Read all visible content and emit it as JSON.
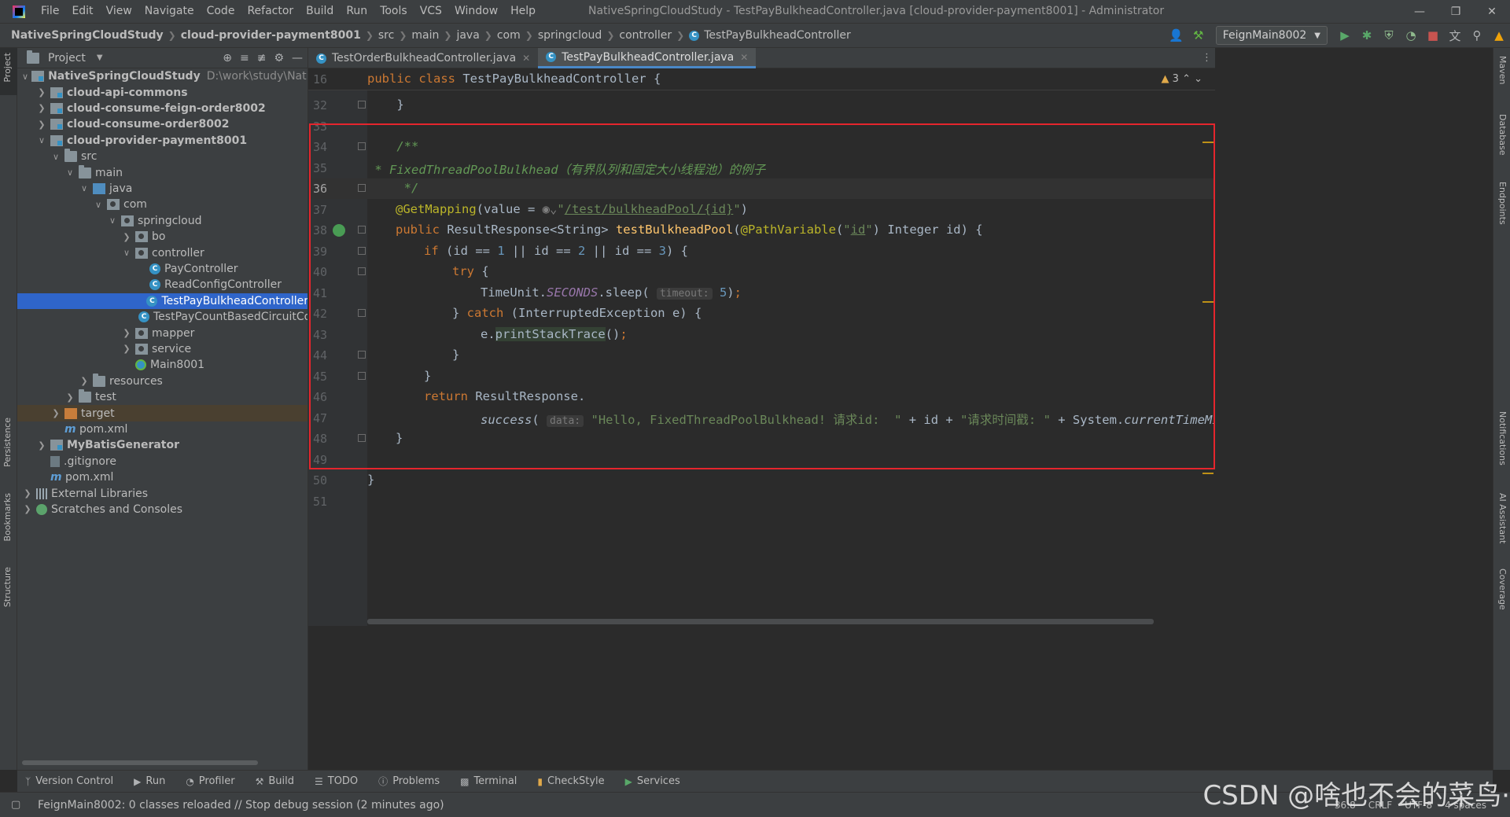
{
  "menu": [
    "File",
    "Edit",
    "View",
    "Navigate",
    "Code",
    "Refactor",
    "Build",
    "Run",
    "Tools",
    "VCS",
    "Window",
    "Help"
  ],
  "window_title": "NativeSpringCloudStudy - TestPayBulkheadController.java [cloud-provider-payment8001] - Administrator",
  "breadcrumbs": [
    "NativeSpringCloudStudy",
    "cloud-provider-payment8001",
    "src",
    "main",
    "java",
    "com",
    "springcloud",
    "controller",
    "TestPayBulkheadController"
  ],
  "run_config": "FeignMain8002",
  "project_panel": {
    "title": "Project",
    "tree": [
      {
        "label": "NativeSpringCloudStudy",
        "extra": "D:\\work\\study\\NativeSpring",
        "depth": 0,
        "arrow": "v",
        "icon": "module",
        "bold": true
      },
      {
        "label": "cloud-api-commons",
        "depth": 1,
        "arrow": ">",
        "icon": "module",
        "bold": true
      },
      {
        "label": "cloud-consume-feign-order8002",
        "depth": 1,
        "arrow": ">",
        "icon": "module",
        "bold": true
      },
      {
        "label": "cloud-consume-order8002",
        "depth": 1,
        "arrow": ">",
        "icon": "module",
        "bold": true
      },
      {
        "label": "cloud-provider-payment8001",
        "depth": 1,
        "arrow": "v",
        "icon": "module",
        "bold": true
      },
      {
        "label": "src",
        "depth": 2,
        "arrow": "v",
        "icon": "folder"
      },
      {
        "label": "main",
        "depth": 3,
        "arrow": "v",
        "icon": "folder"
      },
      {
        "label": "java",
        "depth": 4,
        "arrow": "v",
        "icon": "src"
      },
      {
        "label": "com",
        "depth": 5,
        "arrow": "v",
        "icon": "pkg"
      },
      {
        "label": "springcloud",
        "depth": 6,
        "arrow": "v",
        "icon": "pkg"
      },
      {
        "label": "bo",
        "depth": 7,
        "arrow": ">",
        "icon": "pkg"
      },
      {
        "label": "controller",
        "depth": 7,
        "arrow": "v",
        "icon": "pkg"
      },
      {
        "label": "PayController",
        "depth": 8,
        "arrow": "",
        "icon": "cls"
      },
      {
        "label": "ReadConfigController",
        "depth": 8,
        "arrow": "",
        "icon": "cls"
      },
      {
        "label": "TestPayBulkheadController",
        "depth": 8,
        "arrow": "",
        "icon": "cls",
        "selected": true
      },
      {
        "label": "TestPayCountBasedCircuitCon",
        "depth": 8,
        "arrow": "",
        "icon": "cls"
      },
      {
        "label": "mapper",
        "depth": 7,
        "arrow": ">",
        "icon": "pkg"
      },
      {
        "label": "service",
        "depth": 7,
        "arrow": ">",
        "icon": "pkg"
      },
      {
        "label": "Main8001",
        "depth": 7,
        "arrow": "",
        "icon": "main-cls"
      },
      {
        "label": "resources",
        "depth": 4,
        "arrow": ">",
        "icon": "folder"
      },
      {
        "label": "test",
        "depth": 3,
        "arrow": ">",
        "icon": "folder"
      },
      {
        "label": "target",
        "depth": 2,
        "arrow": ">",
        "icon": "target",
        "excluded": true
      },
      {
        "label": "pom.xml",
        "depth": 2,
        "arrow": "",
        "icon": "mvn"
      },
      {
        "label": "MyBatisGenerator",
        "depth": 1,
        "arrow": ">",
        "icon": "module",
        "bold": true
      },
      {
        "label": ".gitignore",
        "depth": 1,
        "arrow": "",
        "icon": "git"
      },
      {
        "label": "pom.xml",
        "depth": 1,
        "arrow": "",
        "icon": "mvn"
      },
      {
        "label": "External Libraries",
        "depth": 0,
        "arrow": ">",
        "icon": "libs"
      },
      {
        "label": "Scratches and Consoles",
        "depth": 0,
        "arrow": ">",
        "icon": "scratch"
      }
    ]
  },
  "tabs": [
    {
      "label": "TestOrderBulkheadController.java",
      "active": false
    },
    {
      "label": "TestPayBulkheadController.java",
      "active": true
    }
  ],
  "editor": {
    "warnings": "3",
    "sticky": {
      "line": "16",
      "text": "public class TestPayBulkheadController {"
    },
    "lines": [
      {
        "n": "32",
        "text": "    }"
      },
      {
        "n": "33",
        "text": ""
      },
      {
        "n": "34",
        "text": "    /**"
      },
      {
        "n": "35",
        "text": "     * FixedThreadPoolBulkhead（有界队列和固定大小线程池）的例子"
      },
      {
        "n": "36",
        "text": "     */"
      },
      {
        "n": "37",
        "text": "@GetMapping(value = \"/test/bulkheadPool/{id}\")"
      },
      {
        "n": "38",
        "text": "public ResultResponse<String> testBulkheadPool(@PathVariable(\"id\") Integer id) {"
      },
      {
        "n": "39",
        "text": "if (id == 1 || id == 2 || id == 3) {"
      },
      {
        "n": "40",
        "text": "try {"
      },
      {
        "n": "41",
        "text": "TimeUnit.SECONDS.sleep( timeout: 5);"
      },
      {
        "n": "42",
        "text": "} catch (InterruptedException e) {"
      },
      {
        "n": "43",
        "text": "e.printStackTrace();"
      },
      {
        "n": "44",
        "text": "}"
      },
      {
        "n": "45",
        "text": "}"
      },
      {
        "n": "46",
        "text": "return ResultResponse."
      },
      {
        "n": "47",
        "text": "success( data: \"Hello, FixedThreadPoolBulkhead! 请求id:  \" + id + \"请求时间戳: \" + System.currentTimeMillis()"
      },
      {
        "n": "48",
        "text": "}"
      },
      {
        "n": "49",
        "text": ""
      },
      {
        "n": "50",
        "text": "}"
      },
      {
        "n": "51",
        "text": ""
      }
    ],
    "tokens": {
      "mapping_ann": "@GetMapping",
      "mapping_path": "/test/bulkheadPool/{id}",
      "comment_35": " * FixedThreadPoolBulkhead（有界队列和固定大小线程池）的例子",
      "method_name": "testBulkheadPool",
      "seconds": "SECONDS",
      "hint_timeout": "timeout:",
      "print_stack": "printStackTrace",
      "success_fn": "success",
      "hint_data": "data:",
      "success_str1": "\"Hello, FixedThreadPoolBulkhead! 请求id:  \"",
      "success_str2": "\"请求时间戳: \"",
      "current_millis": "currentTimeMillis"
    }
  },
  "left_strip": [
    "Project",
    "Persistence",
    "Bookmarks",
    "Structure"
  ],
  "right_strip": [
    "Maven",
    "Database",
    "Endpoints",
    "Notifications",
    "AI Assistant",
    "Coverage"
  ],
  "bottom_tools": [
    "Version Control",
    "Run",
    "Profiler",
    "Build",
    "TODO",
    "Problems",
    "Terminal",
    "CheckStyle",
    "Services"
  ],
  "status": {
    "message": "FeignMain8002: 0 classes reloaded // Stop debug session (2 minutes ago)",
    "position": "36:8",
    "line_sep": "CRLF",
    "encoding": "UTF-8",
    "indent": "4 spaces"
  },
  "watermark": "CSDN @啥也不会的菜鸟·"
}
